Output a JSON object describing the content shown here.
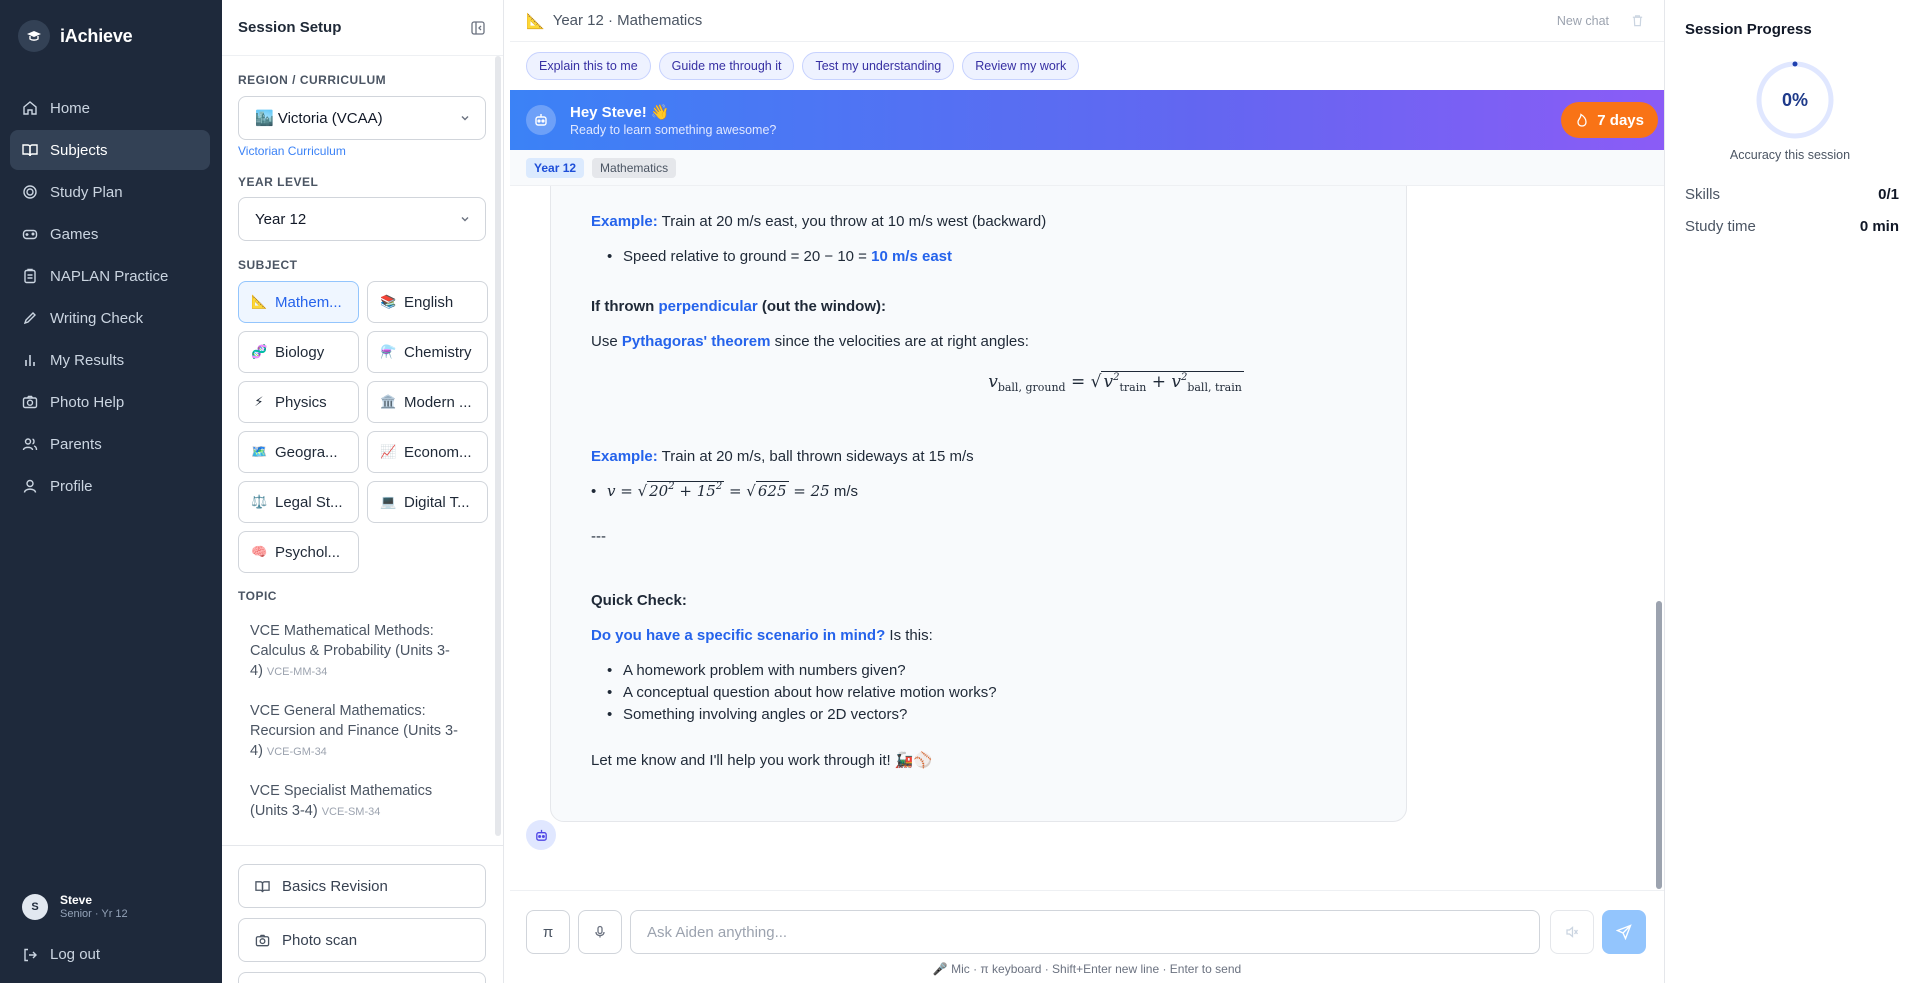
{
  "app": {
    "brand": "iAchieve"
  },
  "nav": {
    "items": [
      {
        "label": "Home"
      },
      {
        "label": "Subjects"
      },
      {
        "label": "Study Plan"
      },
      {
        "label": "Games"
      },
      {
        "label": "NAPLAN Practice"
      },
      {
        "label": "Writing Check"
      },
      {
        "label": "My Results"
      },
      {
        "label": "Photo Help"
      },
      {
        "label": "Parents"
      },
      {
        "label": "Profile"
      }
    ],
    "active": "Subjects",
    "user": {
      "initial": "S",
      "name": "Steve",
      "role": "Senior · Yr 12"
    },
    "logout": "Log out"
  },
  "setup": {
    "title": "Session Setup",
    "region_label": "Region / Curriculum",
    "region_value": "🏙️ Victoria (VCAA)",
    "region_hint": "Victorian Curriculum",
    "year_label": "Year Level",
    "year_value": "Year 12",
    "subject_label": "Subject",
    "subjects": [
      {
        "emoji": "📐",
        "label": "Mathem..."
      },
      {
        "emoji": "📚",
        "label": "English"
      },
      {
        "emoji": "🧬",
        "label": "Biology"
      },
      {
        "emoji": "⚗️",
        "label": "Chemistry"
      },
      {
        "emoji": "⚡",
        "label": "Physics"
      },
      {
        "emoji": "🏛️",
        "label": "Modern ..."
      },
      {
        "emoji": "🗺️",
        "label": "Geogra..."
      },
      {
        "emoji": "📈",
        "label": "Econom..."
      },
      {
        "emoji": "⚖️",
        "label": "Legal St..."
      },
      {
        "emoji": "💻",
        "label": "Digital T..."
      },
      {
        "emoji": "🧠",
        "label": "Psychol..."
      }
    ],
    "selected_subject": "Mathem...",
    "topic_label": "Topic",
    "topics": [
      {
        "title": "VCE Mathematical Methods: Calculus & Probability (Units 3-4)",
        "code": "VCE-MM-34"
      },
      {
        "title": "VCE General Mathematics: Recursion and Finance (Units 3-4)",
        "code": "VCE-GM-34"
      },
      {
        "title": "VCE Specialist Mathematics (Units 3-4)",
        "code": "VCE-SM-34"
      }
    ],
    "footer_buttons": [
      {
        "label": "Basics Revision"
      },
      {
        "label": "Photo scan"
      }
    ]
  },
  "chat": {
    "breadcrumb": "Year 12 · Mathematics",
    "new_chat": "New chat",
    "modes": [
      "Explain this to me",
      "Guide me through it",
      "Test my understanding",
      "Review my work"
    ],
    "banner": {
      "greeting": "Hey Steve! 👋",
      "sub": "Ready to learn something awesome?",
      "streak": "7 days"
    },
    "tags": [
      "Year 12",
      "Mathematics"
    ],
    "message": {
      "ex1_label": "Example:",
      "ex1_text": " Train at 20 m/s east, you throw at 10 m/s west (backward)",
      "ex1_bullet": "Speed relative to ground = 20 − 10 = ",
      "ex1_result": "10 m/s east",
      "perp_a": "If thrown ",
      "perp_b": "perpendicular",
      "perp_c": " (out the window):",
      "use_a": "Use ",
      "use_b": "Pythagoras' theorem",
      "use_c": " since the velocities are at right angles:",
      "ex2_label": "Example:",
      "ex2_text": " Train at 20 m/s, ball thrown sideways at 15 m/s",
      "ex2_unit": " m/s",
      "sep": "---",
      "qc": "Quick Check:",
      "q_a": "Do you have a specific scenario in mind?",
      "q_b": " Is this:",
      "options": [
        "A homework problem with numbers given?",
        "A conceptual question about how relative motion works?",
        "Something involving angles or 2D vectors?"
      ],
      "closing": "Let me know and I'll help you work through it! 🚂⚾"
    },
    "composer": {
      "pi": "π",
      "placeholder": "Ask Aiden anything...",
      "hint": "🎤 Mic · π keyboard · Shift+Enter new line · Enter to send"
    }
  },
  "progress": {
    "title": "Session Progress",
    "accuracy": "0%",
    "accuracy_fraction": 0,
    "accuracy_caption": "Accuracy this session",
    "skills_label": "Skills",
    "skills_value": "0/1",
    "time_label": "Study time",
    "time_value": "0 min"
  },
  "colors": {
    "nav_bg": "#1e293b",
    "accent": "#2563eb",
    "streak": "#f97316",
    "banner_start": "#3b82f6",
    "banner_end": "#8b5cf6"
  }
}
